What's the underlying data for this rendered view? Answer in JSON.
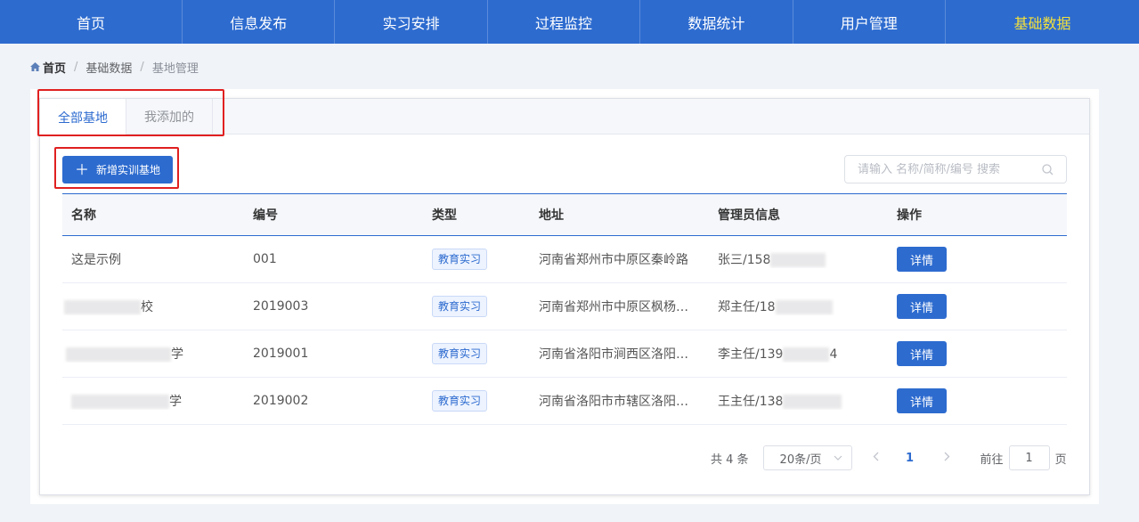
{
  "nav": {
    "items": [
      "首页",
      "信息发布",
      "实习安排",
      "过程监控",
      "数据统计",
      "用户管理",
      "基础数据"
    ],
    "active_index": 6,
    "active_color": "#f5e13a",
    "bg_color": "#2d6bcf"
  },
  "breadcrumb": {
    "home": "首页",
    "level1": "基础数据",
    "current": "基地管理",
    "separator": "/"
  },
  "tabs": [
    {
      "label": "全部基地",
      "active": true
    },
    {
      "label": "我添加的",
      "active": false
    }
  ],
  "toolbar": {
    "add_label": "新增实训基地",
    "add_icon": "plus-icon",
    "search_placeholder": "请输入 名称/简称/编号 搜索",
    "search_icon": "search-icon"
  },
  "table": {
    "headers": [
      "名称",
      "编号",
      "类型",
      "地址",
      "管理员信息",
      "操作"
    ],
    "rows": [
      {
        "name": "这是示例",
        "code": "001",
        "type": "教育实习",
        "address": "河南省郑州市中原区秦岭路",
        "admin": "张三/158",
        "action": "详情"
      },
      {
        "name": "校",
        "code": "2019003",
        "type": "教育实习",
        "address": "河南省郑州市中原区枫杨…",
        "admin": "郑主任/18",
        "action": "详情"
      },
      {
        "name": "学",
        "code": "2019001",
        "type": "教育实习",
        "address": "河南省洛阳市涧西区洛阳…",
        "admin": "李主任/139",
        "admin_tail": "4",
        "action": "详情"
      },
      {
        "name": "学",
        "code": "2019002",
        "type": "教育实习",
        "address": "河南省洛阳市市辖区洛阳…",
        "admin": "王主任/138",
        "action": "详情"
      }
    ]
  },
  "pagination": {
    "total": "共 4 条",
    "page_size": "20条/页",
    "current_page": "1",
    "goto_prefix": "前往",
    "goto_value": "1",
    "goto_suffix": "页"
  },
  "colors": {
    "accent": "#2d6bcf",
    "highlight_box": "#e02020"
  }
}
